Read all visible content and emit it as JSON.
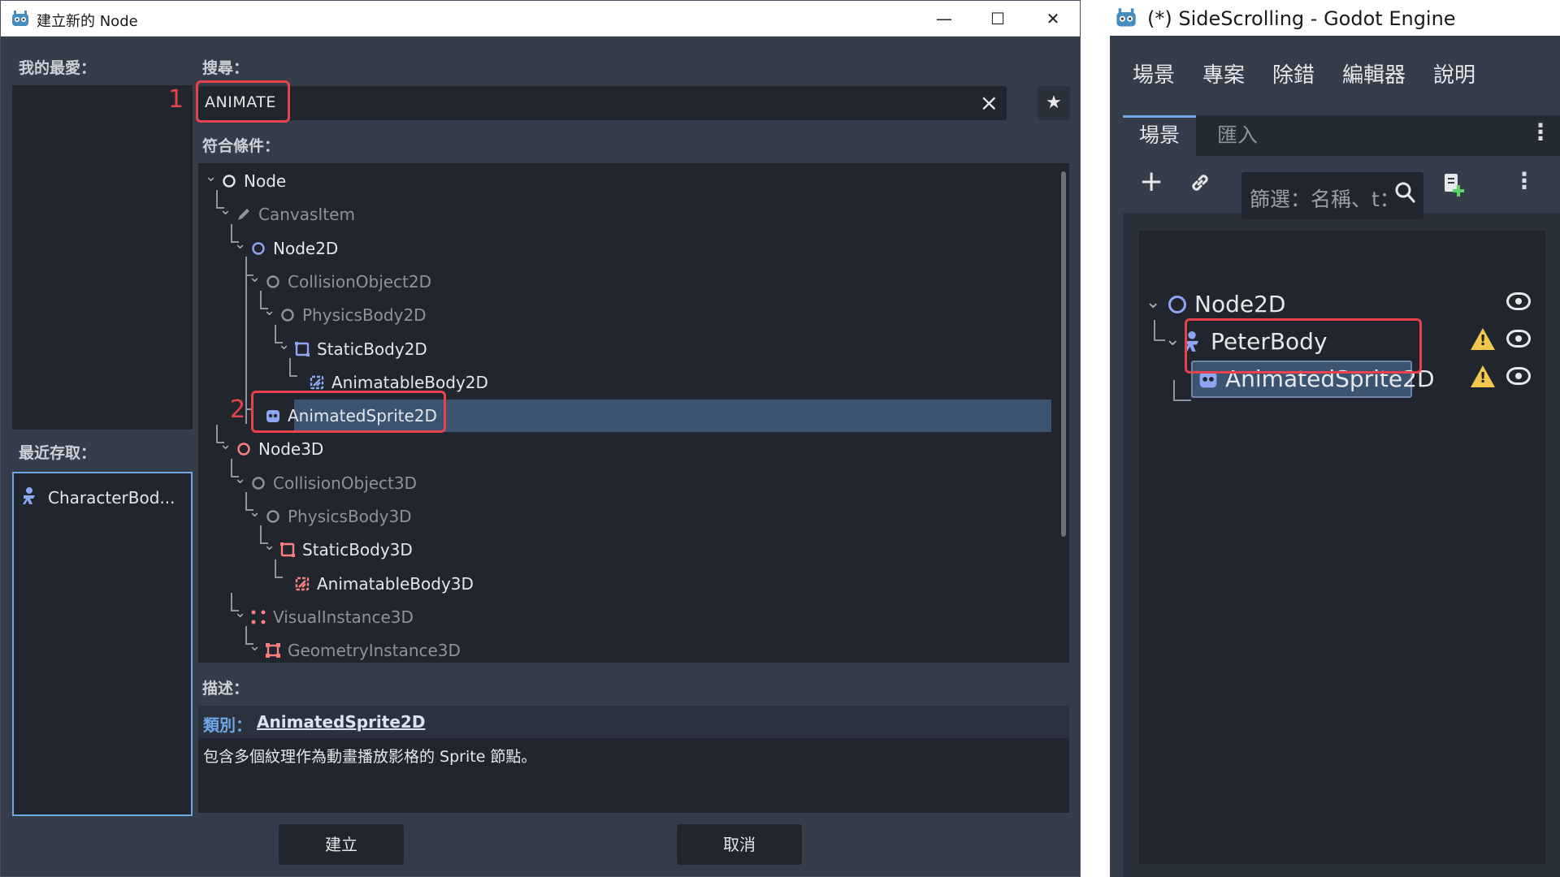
{
  "dialog": {
    "title": "建立新的 Node",
    "window_controls": {
      "minimize": "—",
      "maximize": "☐",
      "close": "✕"
    },
    "favorites_label": "我的最愛：",
    "recent_label": "最近存取：",
    "recent_items": [
      "CharacterBod..."
    ],
    "search_label": "搜尋：",
    "search_value": "ANIMATE",
    "matches_label": "符合條件：",
    "description_label": "描述：",
    "desc_class_key": "類別：",
    "desc_class_value": "AnimatedSprite2D",
    "desc_text": "包含多個紋理作為動畫播放影格的 Sprite 節點。",
    "create_button": "建立",
    "cancel_button": "取消",
    "annotation_1": "1",
    "annotation_2": "2",
    "tree": [
      {
        "label": "Node",
        "icon": "node-circle-icon",
        "color": "#e4e6ea",
        "dim": false
      },
      {
        "label": "CanvasItem",
        "icon": "pencil-icon",
        "color": "#8c939d",
        "dim": true
      },
      {
        "label": "Node2D",
        "icon": "node2d-circle-icon",
        "color": "#8da5f3",
        "dim": false
      },
      {
        "label": "CollisionObject2D",
        "icon": "node-circle-icon",
        "color": "#8c939d",
        "dim": true
      },
      {
        "label": "PhysicsBody2D",
        "icon": "node-circle-icon",
        "color": "#8c939d",
        "dim": true
      },
      {
        "label": "StaticBody2D",
        "icon": "static-body-2d-icon",
        "color": "#8da5f3",
        "dim": false
      },
      {
        "label": "AnimatableBody2D",
        "icon": "animatable-body-2d-icon",
        "color": "#8da5f3",
        "dim": false
      },
      {
        "label": "AnimatedSprite2D",
        "icon": "animated-sprite-2d-icon",
        "color": "#8da5f3",
        "dim": false
      },
      {
        "label": "Node3D",
        "icon": "node3d-circle-icon",
        "color": "#fc7f7f",
        "dim": false
      },
      {
        "label": "CollisionObject3D",
        "icon": "node-circle-icon",
        "color": "#8c939d",
        "dim": true
      },
      {
        "label": "PhysicsBody3D",
        "icon": "node-circle-icon",
        "color": "#8c939d",
        "dim": true
      },
      {
        "label": "StaticBody3D",
        "icon": "static-body-3d-icon",
        "color": "#fc7f7f",
        "dim": false
      },
      {
        "label": "AnimatableBody3D",
        "icon": "animatable-body-3d-icon",
        "color": "#fc7f7f",
        "dim": false
      },
      {
        "label": "VisualInstance3D",
        "icon": "visual-instance-3d-icon",
        "color": "#fc7f7f",
        "dim": true
      },
      {
        "label": "GeometryInstance3D",
        "icon": "geometry-instance-3d-icon",
        "color": "#fc7f7f",
        "dim": true
      }
    ]
  },
  "editor": {
    "title": "(*) SideScrolling - Godot Engine",
    "menu": [
      "場景",
      "專案",
      "除錯",
      "編輯器",
      "說明"
    ],
    "dock_tabs": [
      "場景",
      "匯入"
    ],
    "filter_placeholder": "篩選：名稱、t：",
    "scene_nodes": [
      "Node2D",
      "PeterBody",
      "AnimatedSprite2D"
    ]
  },
  "colors": {
    "accent": "#6fa6e8",
    "highlight": "#e8434a",
    "selection": "#3c5472",
    "node2d": "#8da5f3",
    "node3d": "#fc7f7f",
    "warning": "#f2c94c"
  }
}
